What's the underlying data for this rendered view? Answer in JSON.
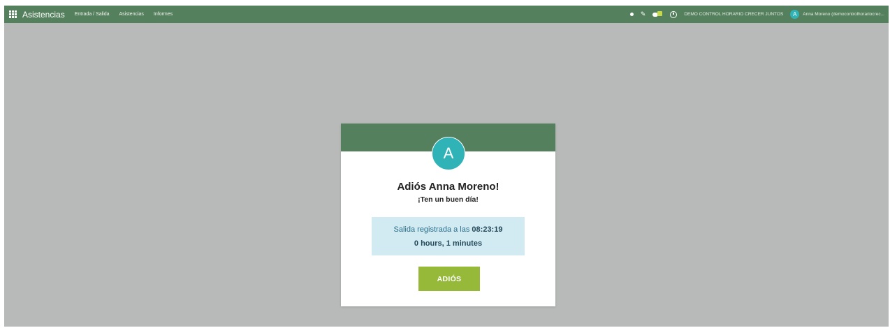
{
  "navbar": {
    "app_name": "Asistencias",
    "menu": [
      "Entrada / Salida",
      "Asistencias",
      "Informes"
    ],
    "icons": [
      "apps-grid-icon",
      "dot-icon",
      "pencil-icon",
      "chat-icon",
      "clock-icon"
    ],
    "company": "DEMO CONTROL HORARIO CRECER JUNTOS",
    "user_initial": "A",
    "user": "Anna Moreno (democontrolhorariocrec..."
  },
  "card": {
    "avatar_initial": "A",
    "goodbye": "Adiós Anna Moreno!",
    "wish": "¡Ten un buen día!",
    "checkout_prefix": "Salida registrada a las",
    "checkout_time": "08:23:19",
    "duration": "0 hours, 1 minutes",
    "button": "ADIÓS"
  },
  "colors": {
    "navbar": "#55805d",
    "background": "#b7bab8",
    "avatar": "#2fb3b6",
    "info_box": "#d2ebf2",
    "button": "#96b93a"
  }
}
